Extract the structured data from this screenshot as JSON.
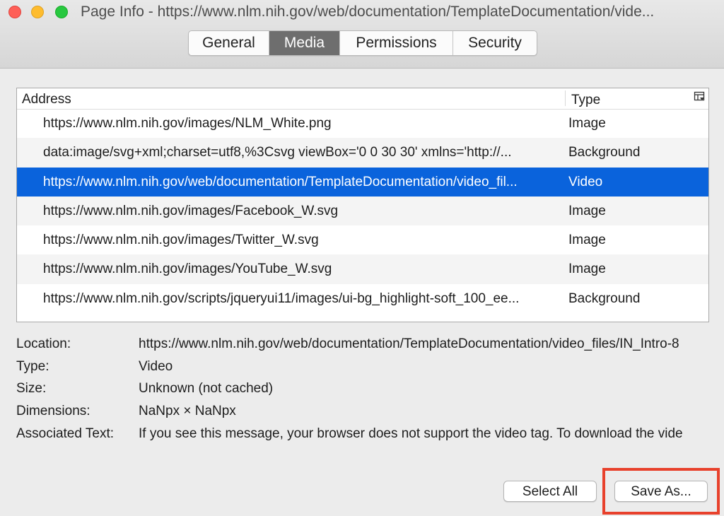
{
  "window": {
    "title": "Page Info - https://www.nlm.nih.gov/web/documentation/TemplateDocumentation/vide...",
    "tabs": [
      {
        "label": "General"
      },
      {
        "label": "Media"
      },
      {
        "label": "Permissions"
      },
      {
        "label": "Security"
      }
    ],
    "active_tab": "Media"
  },
  "media_table": {
    "headers": {
      "address": "Address",
      "type": "Type"
    },
    "rows": [
      {
        "address": "https://www.nlm.nih.gov/images/NLM_White.png",
        "type": "Image"
      },
      {
        "address": "data:image/svg+xml;charset=utf8,%3Csvg viewBox='0 0 30 30' xmlns='http://...",
        "type": "Background"
      },
      {
        "address": "https://www.nlm.nih.gov/web/documentation/TemplateDocumentation/video_fil...",
        "type": "Video"
      },
      {
        "address": "https://www.nlm.nih.gov/images/Facebook_W.svg",
        "type": "Image"
      },
      {
        "address": "https://www.nlm.nih.gov/images/Twitter_W.svg",
        "type": "Image"
      },
      {
        "address": "https://www.nlm.nih.gov/images/YouTube_W.svg",
        "type": "Image"
      },
      {
        "address": "https://www.nlm.nih.gov/scripts/jqueryui11/images/ui-bg_highlight-soft_100_ee...",
        "type": "Background"
      }
    ],
    "selected_row": 2
  },
  "details": {
    "location": {
      "label": "Location:",
      "value": "https://www.nlm.nih.gov/web/documentation/TemplateDocumentation/video_files/IN_Intro-8"
    },
    "type": {
      "label": "Type:",
      "value": "Video"
    },
    "size": {
      "label": "Size:",
      "value": "Unknown (not cached)"
    },
    "dimensions": {
      "label": "Dimensions:",
      "value": "NaNpx × NaNpx"
    },
    "associated_text": {
      "label": "Associated Text:",
      "value": "If you see this message, your browser does not support the video tag. To download the vide"
    }
  },
  "buttons": {
    "select_all": "Select All",
    "save_as": "Save As..."
  },
  "colors": {
    "selection": "#0a63dc",
    "highlight_border": "#e8412c",
    "active_tab": "#6e6e6e",
    "traffic_red": "#fe5f57",
    "traffic_yellow": "#febc2e",
    "traffic_green": "#28c840"
  },
  "icons": {
    "column_picker": "column-picker-icon"
  }
}
